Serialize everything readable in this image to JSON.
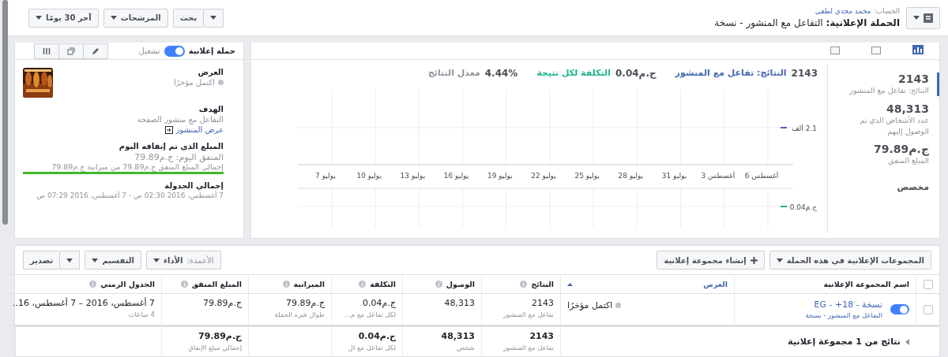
{
  "header": {
    "account_label": "الحساب:",
    "account_name": "محمد مجدي لطفي",
    "title": "**الحملة الإعلانية:** التفاعل مع المنشور - نسخة",
    "buttons": [
      {
        "kind": "split",
        "label": "بحث"
      },
      {
        "kind": "menu",
        "label": "المرشحات"
      },
      {
        "kind": "menu",
        "label": "آخر 30 يومًا"
      }
    ]
  },
  "campaign_panel": {
    "label": "حملة إعلانية",
    "toggle_label": "تشغيل",
    "on": true,
    "delivery_label": "العرض",
    "delivery_status": "اكتمل مؤخرًا",
    "objective_label": "الهدف",
    "objective": "التفاعل مع منشور الصفحة",
    "view_post": "عرض المنشور",
    "spent_today_label": "المبلغ الذي تم إنفاقه اليوم",
    "spent_today": "المنفق اليوم: ج.م79.89",
    "total_spent": "إجمالي المبلغ المنفق ج.م79.89 من ميزانية ج.م79.89",
    "spend_bar": {
      "level": 1
    },
    "schedule_label": "إجمالي الجدولة",
    "schedule": "7 أغسطس، 2016 02:30 ص - 7 أغسطس، 2016 07:29 ص"
  },
  "stats": [
    {
      "value": "2143",
      "label": "النتائج: تفاعل مع المنشور",
      "selected": true
    },
    {
      "value": "48,313",
      "label": "عدد الأشخاص الذي تم الوصول إليهم",
      "selected": false
    },
    {
      "value": "ج.م79.89",
      "label": "المبلغ المنفق",
      "selected": false
    }
  ],
  "stats_custom": "مخصص",
  "chart_header": [
    {
      "kind": "results",
      "value": "2143",
      "label": "النتائج: تفاعل مع المنشور"
    },
    {
      "kind": "cost",
      "value": "ج.م0.04",
      "label": "التكلفة لكل نتيجة"
    },
    {
      "kind": "rate",
      "value": "4.44%",
      "label": "معدل النتائج"
    }
  ],
  "chart": {
    "x_labels": [
      "أغسطس 6",
      "أغسطس 3",
      "يوليو 31",
      "يوليو 28",
      "يوليو 25",
      "يوليو 22",
      "يوليو 19",
      "يوليو 16",
      "يوليو 13",
      "يوليو 10",
      "يوليو 7"
    ],
    "y_labels": [
      "2.1 ألف",
      "ج.م0.04"
    ]
  },
  "table": {
    "toolbar": [
      {
        "kind": "menu",
        "label": "المجموعات الإعلانية في هذه الحملة"
      },
      {
        "kind": "create",
        "label": "إنشاء مجموعة إعلانية"
      }
    ],
    "view_controls": [
      {
        "kind": "columns",
        "prefix": "الأعمدة:",
        "label": "الأداء"
      },
      {
        "kind": "menu",
        "label": "التقسيم"
      },
      {
        "kind": "split",
        "label": "تصدير"
      }
    ],
    "all_selected": false,
    "columns": [
      {
        "label": "اسم المجموعة الإعلانية",
        "kind": "plain",
        "sorted": false
      },
      {
        "label": "العرض",
        "kind": "plain",
        "sorted": true
      },
      {
        "label": "النتائج",
        "kind": "info",
        "sorted": false
      },
      {
        "label": "الوصول",
        "kind": "info",
        "sorted": false
      },
      {
        "label": "التكلفة",
        "kind": "info",
        "sorted": false
      },
      {
        "label": "الميزانية",
        "kind": "info",
        "sorted": false
      },
      {
        "label": "المبلغ المنفق",
        "kind": "info",
        "sorted": false
      },
      {
        "label": "الجدول الزمني",
        "kind": "info",
        "sorted": false
      }
    ],
    "rows": [
      {
        "selected": false,
        "on": true,
        "cells": [
          {
            "kind": "name",
            "text": "نسخة - 18+ - EG",
            "sub": "التفاعل مع المنشور - نسخة"
          },
          {
            "kind": "status",
            "text": "اكتمل مؤخرًا"
          },
          {
            "kind": "value",
            "text": "2143",
            "sub": "تفاعل مع المنشور"
          },
          {
            "kind": "value",
            "text": "48,313"
          },
          {
            "kind": "value",
            "text": "ج.م0.04",
            "sub": "لكل تفاعل مع م..."
          },
          {
            "kind": "value",
            "text": "ج.م79.89",
            "sub": "طوال فترة الحملة"
          },
          {
            "kind": "value",
            "text": "ج.م79.89"
          },
          {
            "kind": "value",
            "text": "7 أغسطس، 2016 – 7 أغسطس، 16..",
            "sub": "4 ساعات"
          }
        ]
      }
    ],
    "summary": {
      "label": "نتائج من 1 مجموعة إعلانية",
      "cells": [
        {
          "kind": "value",
          "text": "2143",
          "sub": "تفاعل مع المنشور"
        },
        {
          "kind": "value",
          "text": "48,313",
          "sub": "شخص"
        },
        {
          "kind": "value",
          "text": "ج.م0.04",
          "sub": "لكل تفاعل مع ال"
        },
        {
          "kind": "empty"
        },
        {
          "kind": "value",
          "text": "ج.م79.89",
          "sub": "إجمالي مبلغ الإنفاق"
        },
        {
          "kind": "empty"
        }
      ]
    }
  }
}
